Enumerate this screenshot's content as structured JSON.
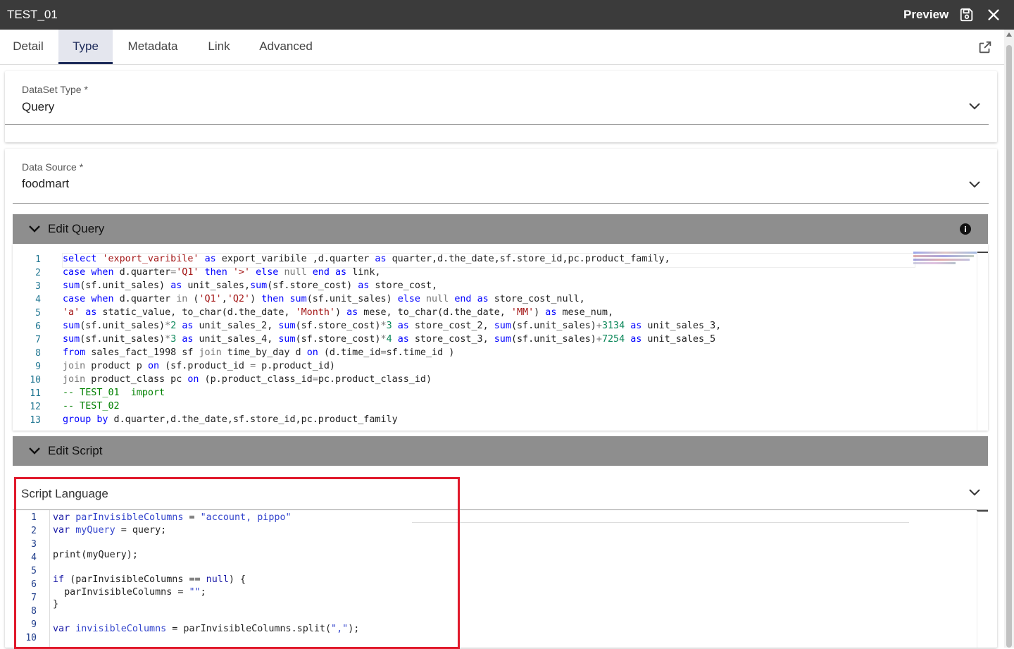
{
  "window": {
    "title": "TEST_01",
    "preview_label": "Preview"
  },
  "tabs": [
    {
      "label": "Detail"
    },
    {
      "label": "Type"
    },
    {
      "label": "Metadata"
    },
    {
      "label": "Link"
    },
    {
      "label": "Advanced"
    }
  ],
  "active_tab": "Type",
  "dataset_type": {
    "label": "DataSet Type *",
    "value": "Query"
  },
  "data_source": {
    "label": "Data Source *",
    "value": "foodmart"
  },
  "edit_query": {
    "title": "Edit Query",
    "line_numbers": [
      "1",
      "2",
      "3",
      "4",
      "5",
      "6",
      "7",
      "8",
      "9",
      "10",
      "11",
      "12",
      "13"
    ]
  },
  "edit_script": {
    "title": "Edit Script",
    "language_label": "Script Language",
    "line_numbers": [
      "1",
      "2",
      "3",
      "4",
      "5",
      "6",
      "7",
      "8",
      "9",
      "10"
    ]
  },
  "icons": {
    "save": "save-icon",
    "close": "close-icon",
    "share": "share-icon",
    "info": "info-icon",
    "chevron": "chevron-down-icon"
  },
  "colors": {
    "titlebar": "#3b3b3b",
    "active_tab": "#e4e6ee",
    "section_header": "#8e8e8e",
    "highlight_box": "#e0192b"
  }
}
